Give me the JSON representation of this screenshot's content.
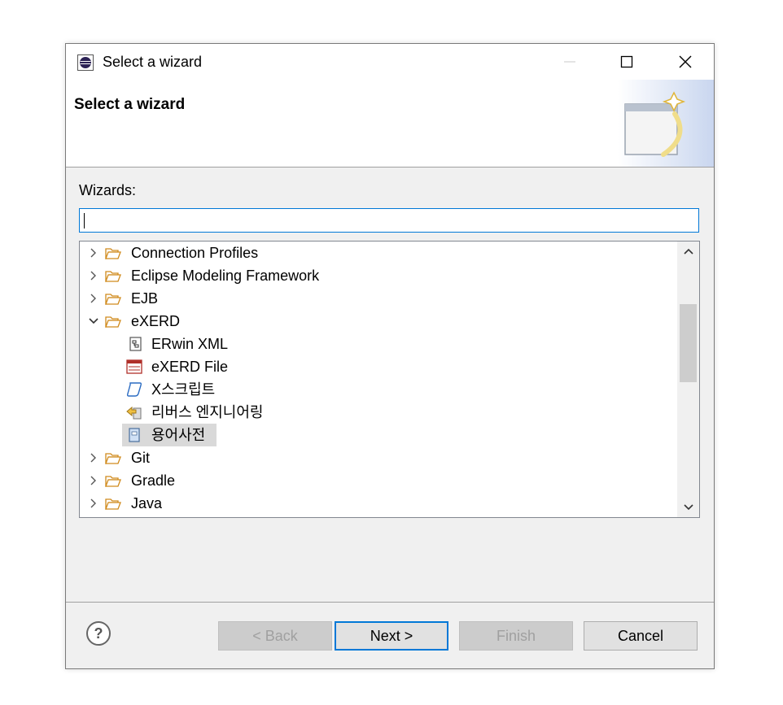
{
  "window": {
    "title": "Select a wizard",
    "minimize_label": "—",
    "maximize_label": "☐",
    "close_label": "✕"
  },
  "header": {
    "title": "Select a wizard"
  },
  "filter": {
    "label": "Wizards:",
    "value": ""
  },
  "tree": {
    "items": [
      {
        "label": "Connection Profiles",
        "type": "folder",
        "expanded": false,
        "level": 0
      },
      {
        "label": "Eclipse Modeling Framework",
        "type": "folder",
        "expanded": false,
        "level": 0
      },
      {
        "label": "EJB",
        "type": "folder",
        "expanded": false,
        "level": 0
      },
      {
        "label": "eXERD",
        "type": "folder",
        "expanded": true,
        "level": 0
      },
      {
        "label": "ERwin XML",
        "type": "erwin-xml-icon",
        "level": 1
      },
      {
        "label": "eXERD File",
        "type": "exerd-file-icon",
        "level": 1
      },
      {
        "label": "X스크립트",
        "type": "script-icon",
        "level": 1
      },
      {
        "label": "리버스 엔지니어링",
        "type": "reverse-engineering-icon",
        "level": 1
      },
      {
        "label": "용어사전",
        "type": "dictionary-icon",
        "level": 1,
        "selected": true
      },
      {
        "label": "Git",
        "type": "folder",
        "expanded": false,
        "level": 0
      },
      {
        "label": "Gradle",
        "type": "folder",
        "expanded": false,
        "level": 0
      },
      {
        "label": "Java",
        "type": "folder",
        "expanded": false,
        "level": 0
      }
    ]
  },
  "buttons": {
    "back": "< Back",
    "next": "Next >",
    "finish": "Finish",
    "cancel": "Cancel"
  },
  "colors": {
    "accent": "#0078d7",
    "folder": "#e8a93a",
    "selection": "#d9d9d9"
  }
}
